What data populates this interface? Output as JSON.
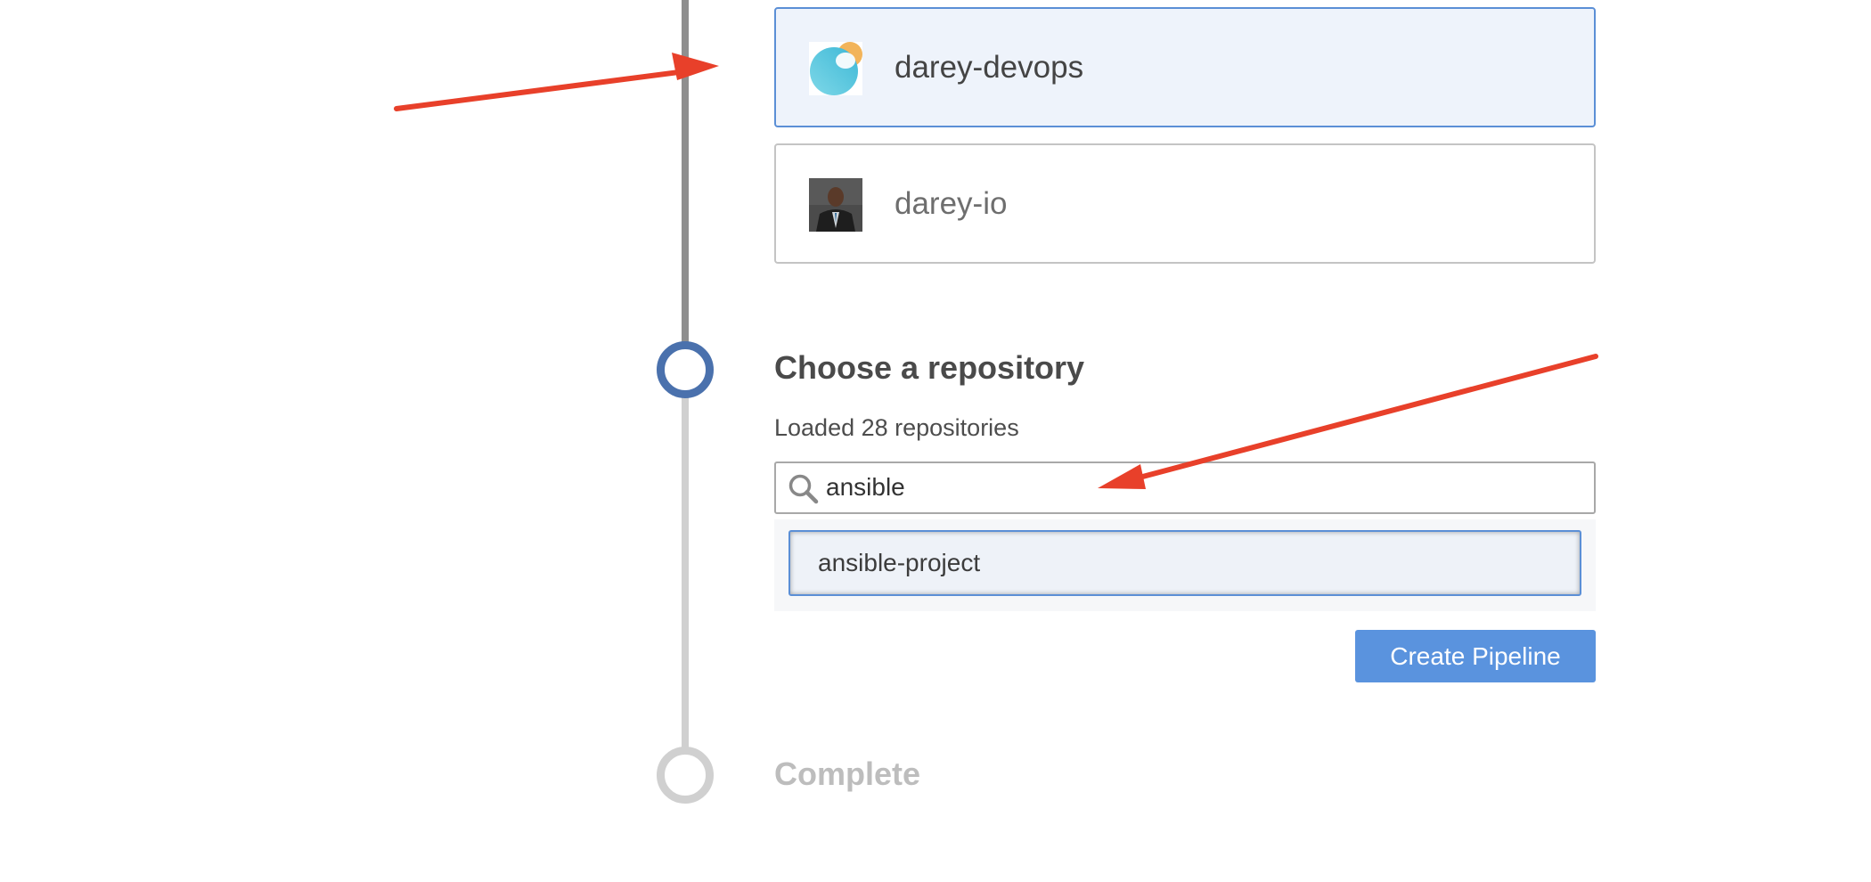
{
  "organizations": [
    {
      "name": "darey-devops",
      "avatar": "abstract-logo-icon",
      "selected": true
    },
    {
      "name": "darey-io",
      "avatar": "user-photo-avatar",
      "selected": false
    }
  ],
  "repository_step": {
    "title": "Choose a repository",
    "status": "Loaded 28 repositories",
    "search_value": "ansible",
    "results": [
      "ansible-project"
    ],
    "create_button": "Create Pipeline"
  },
  "complete_step": {
    "title": "Complete"
  },
  "colors": {
    "accent": "#4a71ad",
    "button": "#5a93de",
    "selection_border": "#5b8fd6",
    "selection_bg": "#eef3fb",
    "annotation_arrow": "#e8402a"
  }
}
